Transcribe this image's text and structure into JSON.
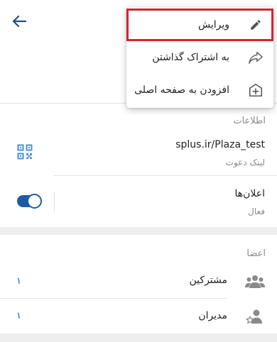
{
  "menu": {
    "items": [
      {
        "label": "ویرایش",
        "icon": "pencil-icon",
        "highlighted": true
      },
      {
        "label": "به اشتراک گذاشتن",
        "icon": "share-arrow-icon"
      },
      {
        "label": "افزودن به صفحه اصلی",
        "icon": "add-to-home-icon"
      }
    ]
  },
  "info": {
    "section_title": "اطلاعات",
    "invite_link": "splus.ir/Plaza_test",
    "invite_link_caption": "لینک دعوت",
    "notifications_label": "اعلان‌ها",
    "notifications_status": "فعال",
    "notifications_on": true
  },
  "members": {
    "section_title": "اعضا",
    "subscribers_label": "مشترکین",
    "subscribers_count": "۱",
    "admins_label": "مدیران",
    "admins_count": "۱"
  },
  "colors": {
    "accent": "#1f5aa6",
    "highlight_frame": "#d8232a",
    "qr_icon": "#4a90d9",
    "icon_gray": "#8a8a8a"
  }
}
